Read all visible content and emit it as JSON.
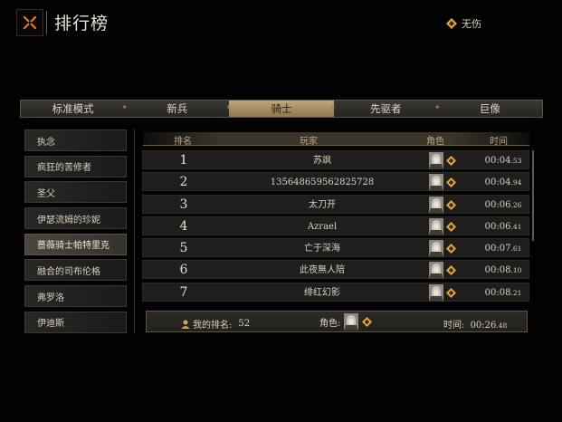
{
  "header": {
    "title": "排行榜",
    "mode_label": "无伤",
    "close_icon": "close-x-icon"
  },
  "tabs": [
    {
      "label": "标准模式",
      "active": false
    },
    {
      "label": "新兵",
      "active": false
    },
    {
      "label": "骑士",
      "active": true
    },
    {
      "label": "先驱者",
      "active": false
    },
    {
      "label": "巨像",
      "active": false
    }
  ],
  "bosses": [
    {
      "label": "执念",
      "active": false
    },
    {
      "label": "疯狂的苦修者",
      "active": false
    },
    {
      "label": "圣父",
      "active": false
    },
    {
      "label": "伊瑟流姆的珍妮",
      "active": false
    },
    {
      "label": "蔷薇骑士帕特里克",
      "active": true
    },
    {
      "label": "融合的司布伦格",
      "active": false
    },
    {
      "label": "弗罗洛",
      "active": false
    },
    {
      "label": "伊迪斯",
      "active": false
    }
  ],
  "table": {
    "headers": {
      "rank": "排名",
      "player": "玩家",
      "character": "角色",
      "time": "时间"
    },
    "rows": [
      {
        "rank": "1",
        "player": "苏飒",
        "time": "00:04",
        "ms": ".53"
      },
      {
        "rank": "2",
        "player": "135648659562825728",
        "time": "00:04",
        "ms": ".94"
      },
      {
        "rank": "3",
        "player": "太刀开",
        "time": "00:06",
        "ms": ".26"
      },
      {
        "rank": "4",
        "player": "Azrael",
        "time": "00:06",
        "ms": ".41"
      },
      {
        "rank": "5",
        "player": "亡于深海",
        "time": "00:07",
        "ms": ".61"
      },
      {
        "rank": "6",
        "player": "此夜無人陪",
        "time": "00:08",
        "ms": ".10"
      },
      {
        "rank": "7",
        "player": "绯红幻影",
        "time": "00:08",
        "ms": ".21"
      }
    ]
  },
  "my_rank": {
    "rank_label": "我的排名:",
    "rank_value": "52",
    "char_label": "角色:",
    "time_label": "时间:",
    "time_value": "00:26",
    "time_ms": ".48"
  },
  "colors": {
    "background": "#020202",
    "active_tab": "#a88f63",
    "accent_gold": "#e0a64a",
    "close_orange": "#d9832e"
  }
}
